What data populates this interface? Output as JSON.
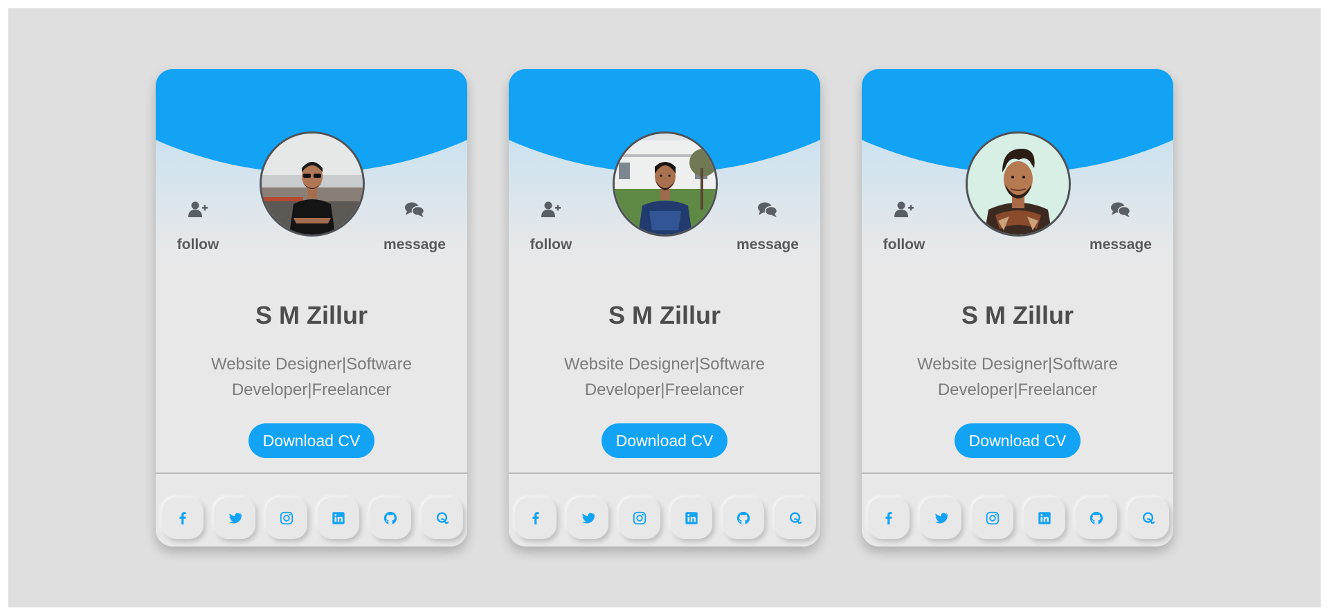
{
  "colors": {
    "accent": "#12a3f5",
    "icon_dark": "#5a5f66",
    "background": "#dfdfdf"
  },
  "cards": [
    {
      "name": "S M Zillur",
      "role": "Website Designer|Software Developer|Freelancer",
      "follow_label": "follow",
      "message_label": "message",
      "cv_label": "Download CV",
      "photo": "man-in-black-shirt-sunglasses-photo"
    },
    {
      "name": "S M Zillur",
      "role": "Website Designer|Software Developer|Freelancer",
      "follow_label": "follow",
      "message_label": "message",
      "cv_label": "Download CV",
      "photo": "man-in-blue-jersey-photo"
    },
    {
      "name": "S M Zillur",
      "role": "Website Designer|Software Developer|Freelancer",
      "follow_label": "follow",
      "message_label": "message",
      "cv_label": "Download CV",
      "photo": "man-with-scarf-portrait-photo"
    }
  ],
  "social_icons": [
    "facebook-icon",
    "twitter-icon",
    "instagram-icon",
    "linkedin-icon",
    "github-icon",
    "quora-icon"
  ],
  "action_icons": {
    "follow": "user-plus-icon",
    "message": "comments-icon"
  }
}
